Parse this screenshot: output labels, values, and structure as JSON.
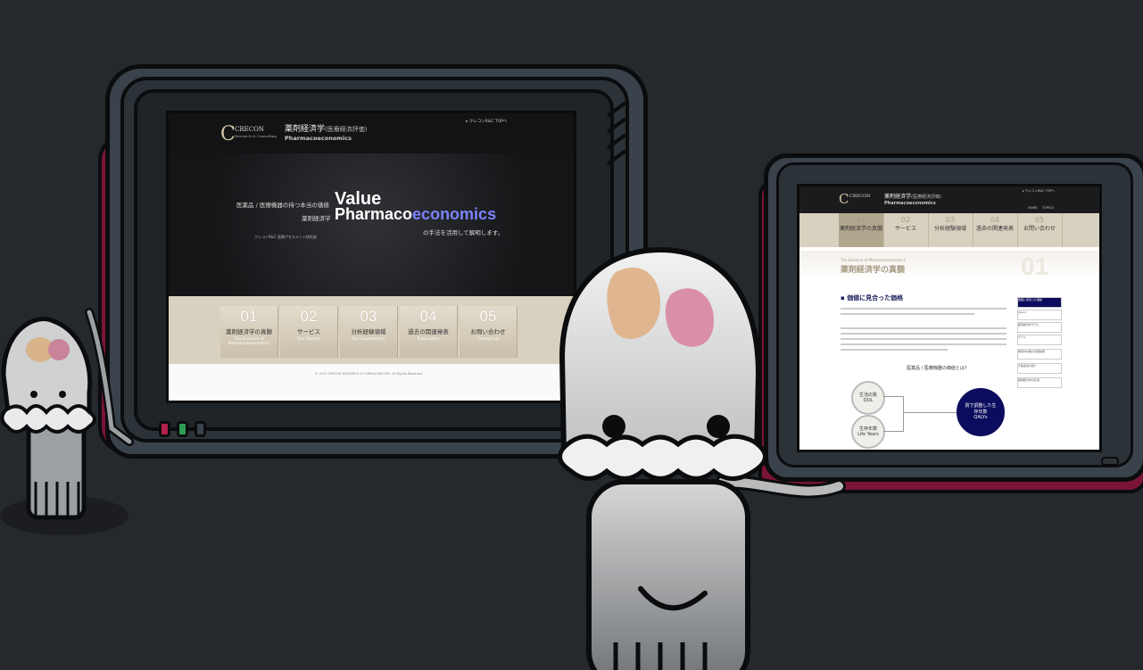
{
  "left_site": {
    "logo_brand": "CRECON",
    "logo_sub": "Research & Consulting",
    "title_jp": "薬剤経済学",
    "title_paren": "(医療経済評価)",
    "title_en": "Pharmacoeconomics",
    "top_link": "クレコンR&C TOPへ",
    "hero_line1_jp": "医薬品 / 医療機器の持つ本当の価値",
    "hero_value": "Value",
    "hero_line2_jp": "薬剤経済学",
    "hero_pharma_a": "Pharmaco",
    "hero_pharma_b": "economics",
    "hero_line3_jp": "の手法を活用して解明します。",
    "hero_small": "クレコンR&C 医療アセスメント研究部",
    "cards": [
      {
        "num": "01",
        "jp": "薬剤経済学の真髄",
        "en": "The Essence of Pharmacoeconomics"
      },
      {
        "num": "02",
        "jp": "サービス",
        "en": "Our Service"
      },
      {
        "num": "03",
        "jp": "分析経験領域",
        "en": "Our Experiences"
      },
      {
        "num": "04",
        "jp": "過去の関連発表",
        "en": "Publication"
      },
      {
        "num": "05",
        "jp": "お問い合わせ",
        "en": "Contact us"
      }
    ],
    "copyright": "© 2013 CRECON RESEARCH & CONSULTING INC. All Rights Reserved."
  },
  "right_site": {
    "logo_brand": "CRECON",
    "title_jp": "薬剤経済学",
    "title_paren": "(医療経済評価)",
    "title_en": "Pharmacoeconomics",
    "top_link": "クレコンR&C TOPへ",
    "nav_home": "HOME",
    "nav_topics": "TOPICS",
    "tabs": [
      {
        "num": "01",
        "jp": "薬剤経済学の真髄"
      },
      {
        "num": "02",
        "jp": "サービス"
      },
      {
        "num": "03",
        "jp": "分析経験領域"
      },
      {
        "num": "04",
        "jp": "過去の関連発表"
      },
      {
        "num": "05",
        "jp": "お問い合わせ"
      }
    ],
    "page_kicker": "The Essence of Pharmacoeconomics",
    "page_title": "薬剤経済学の真髄",
    "page_num": "01",
    "section_heading": "価値に見合った価格",
    "figure_caption": "医薬品 / 医療機器の価値とは?",
    "bubble_qol": "生活の質",
    "bubble_qol_en": "QOL",
    "bubble_life": "生存年数",
    "bubble_life_en": "Life Years",
    "bubble_qaly": "質で調整した生存年数",
    "bubble_qaly_en": "QALYs",
    "side_items": [
      "価値に見合った価格",
      "QALYs",
      "薬剤経済学モデル",
      "モデル",
      "費用対効果の評価指標",
      "不確実性の扱い",
      "薬剤経済学の応用"
    ]
  }
}
